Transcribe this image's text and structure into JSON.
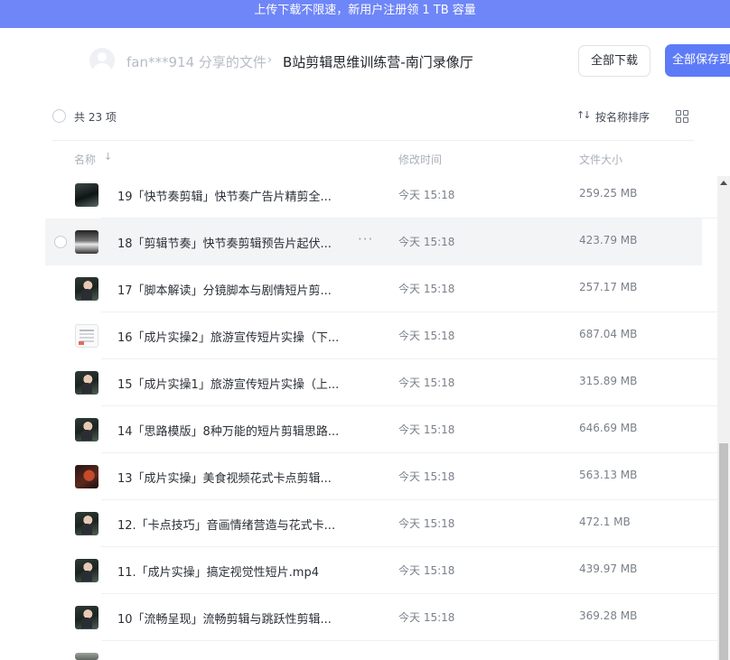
{
  "promo": {
    "text": "上传下载不限速，新用户注册领 1 TB 容量"
  },
  "header": {
    "owner": "fan***914 分享的文件",
    "separator": "›",
    "folder": "B站剪辑思维训练营-南门录像厅",
    "download_all": "全部下载",
    "save_all": "全部保存到"
  },
  "toolbar": {
    "count": "共 23 项",
    "sort": "按名称排序"
  },
  "columns": {
    "name": "名称",
    "name_arrow": "↓",
    "time": "修改时间",
    "size": "文件大小"
  },
  "files": [
    {
      "name": "19「快节奏剪辑」快节奏广告片精剪全...",
      "time": "今天 15:18",
      "size": "259.25 MB"
    },
    {
      "name": "18「剪辑节奏」快节奏剪辑预告片起伏...",
      "time": "今天 15:18",
      "size": "423.79 MB",
      "more": "···"
    },
    {
      "name": "17「脚本解读」分镜脚本与剧情短片剪...",
      "time": "今天 15:18",
      "size": "257.17 MB"
    },
    {
      "name": "16「成片实操2」旅游宣传短片实操（下...",
      "time": "今天 15:18",
      "size": "687.04 MB"
    },
    {
      "name": "15「成片实操1」旅游宣传短片实操（上...",
      "time": "今天 15:18",
      "size": "315.89 MB"
    },
    {
      "name": "14「思路模版」8种万能的短片剪辑思路...",
      "time": "今天 15:18",
      "size": "646.69 MB"
    },
    {
      "name": "13「成片实操」美食视频花式卡点剪辑...",
      "time": "今天 15:18",
      "size": "563.13 MB"
    },
    {
      "name": "12.「卡点技巧」音画情绪营造与花式卡...",
      "time": "今天 15:18",
      "size": "472.1 MB"
    },
    {
      "name": "11.「成片实操」搞定视觉性短片.mp4",
      "time": "今天 15:18",
      "size": "439.97 MB"
    },
    {
      "name": "10「流畅呈现」流畅剪辑与跳跃性剪辑...",
      "time": "今天 15:18",
      "size": "369.28 MB"
    }
  ]
}
